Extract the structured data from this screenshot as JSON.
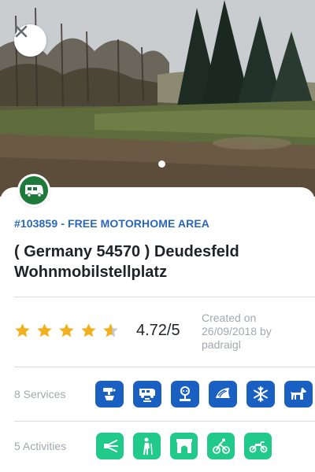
{
  "place": {
    "id_line": "#103859 - FREE MOTORHOME AREA",
    "title": "( Germany 54570 ) Deudesfeld Wohnmobilstellplatz",
    "type_icon": "motorhome-icon",
    "type_color": "#1d7a3a"
  },
  "gallery": {
    "current_photo": 1
  },
  "rating": {
    "stars": 4.72,
    "value_text": "4.72/5",
    "star_color": "#f2b01e"
  },
  "created": {
    "text": "Created on 26/09/2018 by padraigl"
  },
  "services": {
    "label": "8 Services",
    "color": "#1a5fc2",
    "icons": [
      "drinking-water-icon",
      "motorhome-drain-icon",
      "electricity-icon",
      "shower-icon",
      "winter-icon",
      "pets-allowed-icon"
    ]
  },
  "activities": {
    "label": "5 Activities",
    "color": "#21c98a",
    "icons": [
      "viewpoint-icon",
      "hiking-icon",
      "monument-icon",
      "cycling-icon",
      "motorbike-icon"
    ]
  }
}
